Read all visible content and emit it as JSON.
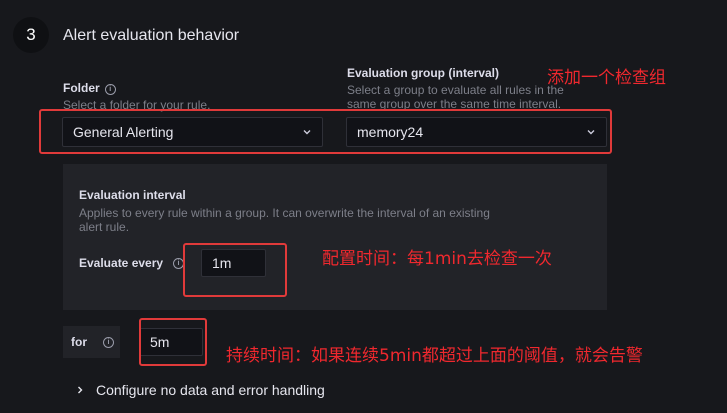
{
  "step": {
    "number": "3",
    "title": "Alert evaluation behavior"
  },
  "folder": {
    "label": "Folder",
    "description": "Select a folder for your rule.",
    "value": "General Alerting"
  },
  "evaluation_group": {
    "label": "Evaluation group (interval)",
    "description_line1": "Select a group to evaluate all rules in the",
    "description_line2": "same group over the same time interval.",
    "value": "memory24"
  },
  "evaluation_interval": {
    "title": "Evaluation interval",
    "description_line1": "Applies to every rule within a group. It can overwrite the interval of an existing",
    "description_line2": "alert rule.",
    "evaluate_every_label": "Evaluate every",
    "evaluate_every_value": "1m"
  },
  "pending": {
    "for_label": "for",
    "for_value": "5m"
  },
  "expand": {
    "label": "Configure no data and error handling"
  },
  "annotations": {
    "group": "添加一个检查组",
    "interval": "配置时间：每1min去检查一次",
    "for": "持续时间：如果连续5min都超过上面的阈值，就会告警"
  },
  "colors": {
    "annotation": "#f0282e",
    "background": "#17181c",
    "panel": "#222328"
  }
}
